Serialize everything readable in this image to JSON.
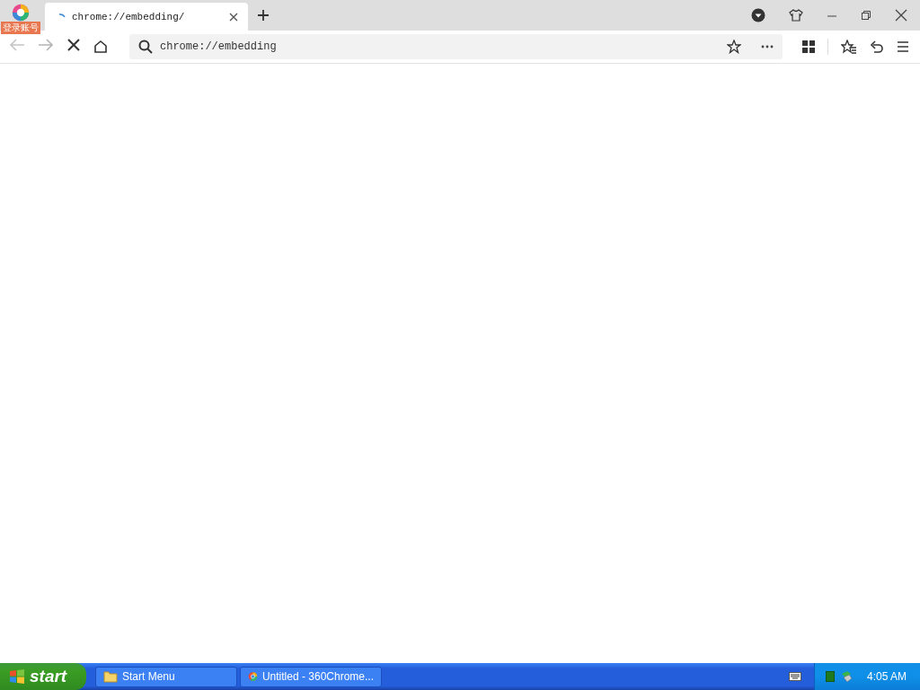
{
  "browser": {
    "account_badge": "登录账号",
    "tabs": [
      {
        "title": "chrome://embedding/",
        "selected": true,
        "loading": true
      }
    ],
    "nav": {
      "back_disabled": true,
      "forward_disabled": true,
      "loading": true
    },
    "address": {
      "value": "chrome://embedding"
    }
  },
  "taskbar": {
    "start": "start",
    "tasks": [
      {
        "label": "Start Menu",
        "kind": "folder",
        "selected": false
      },
      {
        "label": "Untitled - 360Chrome...",
        "kind": "browser",
        "selected": false
      }
    ],
    "clock": "4:05 AM"
  }
}
